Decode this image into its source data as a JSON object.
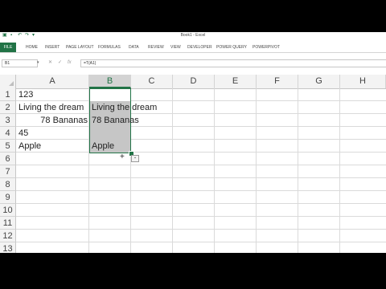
{
  "window": {
    "title": "Book1 - Excel"
  },
  "ribbon": {
    "file_tab": "FILE",
    "tabs": [
      "HOME",
      "INSERT",
      "PAGE LAYOUT",
      "FORMULAS",
      "DATA",
      "REVIEW",
      "VIEW",
      "DEVELOPER",
      "POWER QUERY",
      "POWERPIVOT"
    ]
  },
  "formula_bar": {
    "name_box": "B1",
    "cancel": "✕",
    "enter": "✓",
    "fx": "fx",
    "formula": "=T(A1)"
  },
  "columns": [
    "A",
    "B",
    "C",
    "D",
    "E",
    "F",
    "G",
    "H"
  ],
  "rows": [
    "1",
    "2",
    "3",
    "4",
    "5",
    "6",
    "7",
    "8",
    "9",
    "10",
    "11",
    "12",
    "13"
  ],
  "cells": {
    "A1": "123",
    "A2": "Living the dream",
    "A3": "78 Bananas",
    "A4": "45",
    "A5": "Apple",
    "B2": "Living the dream",
    "B3": "78 Bananas",
    "B5": "Apple"
  },
  "colors": {
    "accent": "#217346"
  },
  "icons": {
    "quick_analysis": "quick-analysis-icon",
    "cursor": "plus-cursor-icon"
  }
}
